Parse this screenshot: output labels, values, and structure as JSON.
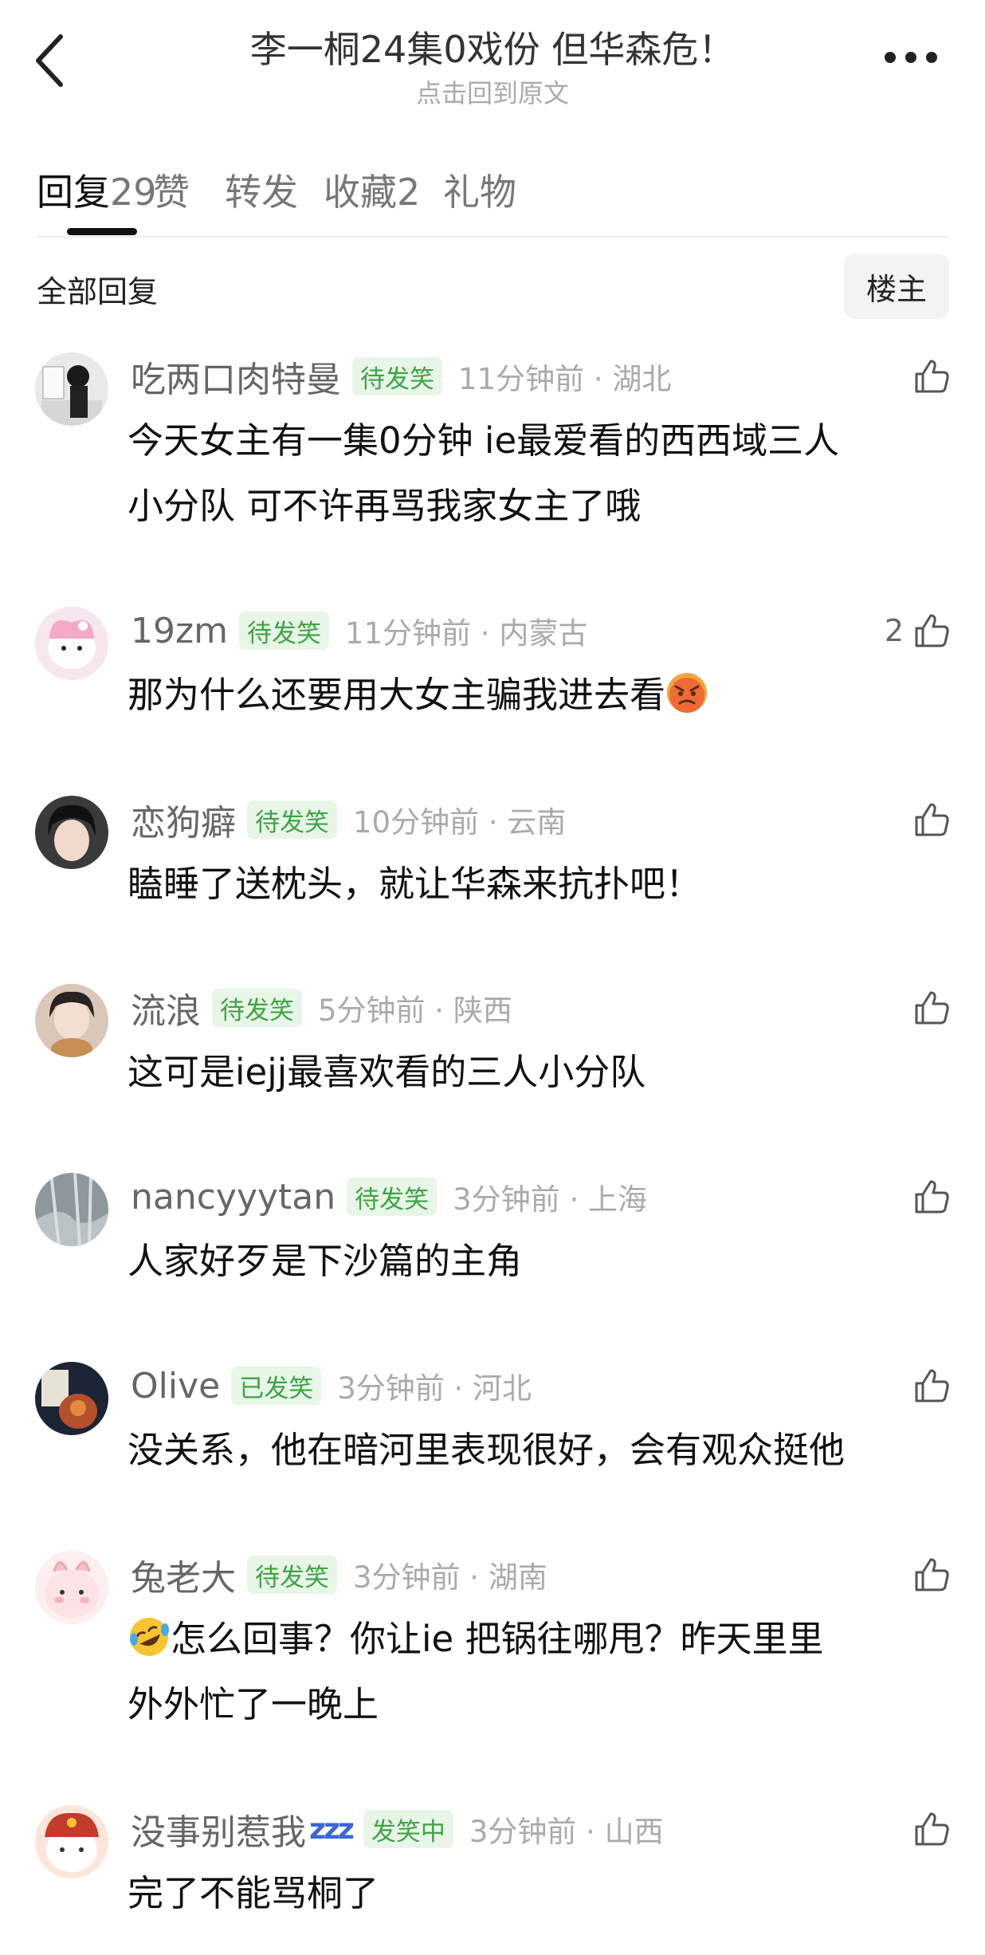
{
  "header": {
    "title": "李一桐24集0戏份 但华森危！",
    "subtitle": "点击回到原文"
  },
  "tabs": [
    {
      "label": "回复",
      "count": "29"
    },
    {
      "label": "赞",
      "count": ""
    },
    {
      "label": "转发",
      "count": ""
    },
    {
      "label": "收藏",
      "count": "2"
    },
    {
      "label": "礼物",
      "count": ""
    }
  ],
  "section": {
    "title": "全部回复",
    "owner_button": "楼主"
  },
  "colors": {
    "badge_green": "#3fa344",
    "badge_bg": "#e8f6e8",
    "accent_blue": "#3a66d8"
  },
  "comments": [
    {
      "username": "吃两口肉特曼",
      "badge": "待发笑",
      "time": "11分钟前 · 湖北",
      "likes": "",
      "lines": [
        "今天女主有一集0分钟 ie最爱看的西西域三人",
        "小分队 可不许再骂我家女主了哦"
      ]
    },
    {
      "username": "19zm",
      "badge": "待发笑",
      "time": "11分钟前 · 内蒙古",
      "likes": "2",
      "lines": [
        "那为什么还要用大女主骗我进去看"
      ],
      "emoji": "angry-face-emoji"
    },
    {
      "username": "恋狗癖",
      "badge": "待发笑",
      "time": "10分钟前 · 云南",
      "likes": "",
      "lines": [
        "瞌睡了送枕头，就让华森来抗扑吧！"
      ]
    },
    {
      "username": "流浪",
      "badge": "待发笑",
      "time": "5分钟前 · 陕西",
      "likes": "",
      "lines": [
        "这可是iejj最喜欢看的三人小分队"
      ]
    },
    {
      "username": "nancyyytan",
      "badge": "待发笑",
      "time": "3分钟前 · 上海",
      "likes": "",
      "lines": [
        "人家好歹是下沙篇的主角"
      ]
    },
    {
      "username": "Olive",
      "badge": "已发笑",
      "time": "3分钟前 · 河北",
      "likes": "",
      "lines": [
        "没关系，他在暗河里表现很好，会有观众挺他"
      ]
    },
    {
      "username": "兔老大",
      "badge": "待发笑",
      "time": "3分钟前 · 湖南",
      "likes": "",
      "lines": [
        "怎么回事？你让ie 把锅往哪甩？昨天里里",
        "外外忙了一晚上"
      ],
      "emoji": "rofl-emoji"
    },
    {
      "username": "没事别惹我",
      "badge": "发笑中",
      "time": "3分钟前 · 山西",
      "likes": "",
      "lines": [
        "完了不能骂桐了"
      ],
      "name_suffix": "zzz"
    }
  ]
}
